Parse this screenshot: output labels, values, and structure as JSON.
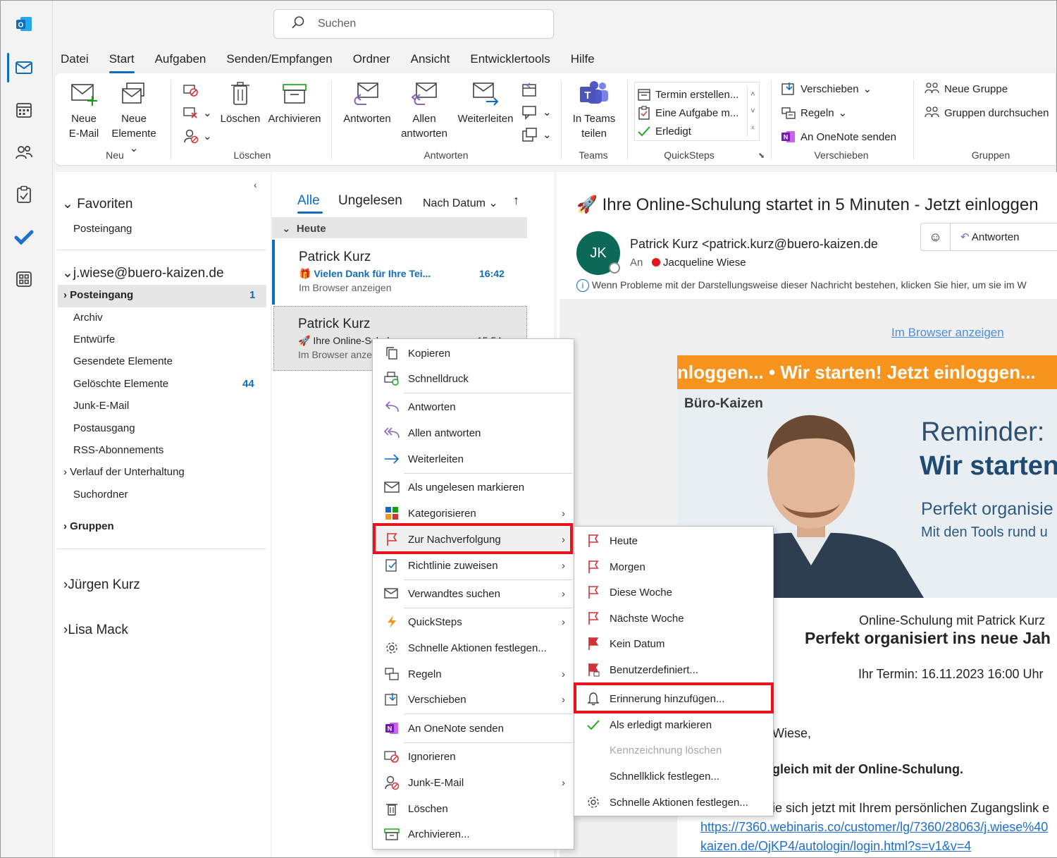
{
  "app": {
    "search_placeholder": "Suchen"
  },
  "tabs": [
    "Datei",
    "Start",
    "Aufgaben",
    "Senden/Empfangen",
    "Ordner",
    "Ansicht",
    "Entwicklertools",
    "Hilfe"
  ],
  "ribbon": {
    "new_mail": [
      "Neue",
      "E-Mail"
    ],
    "new_items": [
      "Neue",
      "Elemente"
    ],
    "group_new": "Neu",
    "delete": "Löschen",
    "archive": "Archivieren",
    "group_delete": "Löschen",
    "reply": "Antworten",
    "reply_all": [
      "Allen",
      "antworten"
    ],
    "forward": "Weiterleiten",
    "group_reply": "Antworten",
    "teams": [
      "In Teams",
      "teilen"
    ],
    "group_teams": "Teams",
    "qs_items": [
      "Termin erstellen...",
      "Eine Aufgabe m...",
      "Erledigt"
    ],
    "group_quicksteps": "QuickSteps",
    "move": "Verschieben",
    "rules": "Regeln",
    "onenote": "An OneNote senden",
    "group_move": "Verschieben",
    "new_group": "Neue Gruppe",
    "browse_groups": "Gruppen durchsuchen",
    "group_groups": "Gruppen"
  },
  "folders": {
    "favorites": "Favoriten",
    "fav_inbox": "Posteingang",
    "account": "j.wiese@buero-kaizen.de",
    "inbox": "Posteingang",
    "inbox_count": "1",
    "archive": "Archiv",
    "drafts": "Entwürfe",
    "sent": "Gesendete Elemente",
    "deleted": "Gelöschte Elemente",
    "deleted_count": "44",
    "junk": "Junk-E-Mail",
    "outbox": "Postausgang",
    "rss": "RSS-Abonnements",
    "history": "Verlauf der Unterhaltung",
    "search": "Suchordner",
    "groups": "Gruppen",
    "person1": "Jürgen Kurz",
    "person2": "Lisa Mack"
  },
  "list": {
    "tab_all": "Alle",
    "tab_unread": "Ungelesen",
    "sort": "Nach Datum",
    "section": "Heute",
    "m1_sender": "Patrick Kurz",
    "m1_subject": "Vielen Dank für Ihre Tei...",
    "m1_time": "16:42",
    "m1_preview": "Im Browser anzeigen",
    "m2_sender": "Patrick Kurz",
    "m2_subject": "Ihre Online-Schulu",
    "m2_time": "15:54",
    "m2_preview": "Im Browser anze"
  },
  "reading": {
    "subject": "Ihre Online-Schulung startet in 5 Minuten - Jetzt einloggen",
    "avatar": "JK",
    "from": "Patrick Kurz <patrick.kurz@buero-kaizen.de",
    "to_label": "An",
    "to_name": "Jacqueline Wiese",
    "reply": "Antworten",
    "info": "Wenn Probleme mit der Darstellungsweise dieser Nachricht bestehen, klicken Sie hier, um sie im W",
    "browser_link": "Im Browser anzeigen",
    "banner": "nloggen... •  Wir starten! Jetzt einloggen...",
    "brand": "Büro-Kaizen",
    "reminder": "Reminder:",
    "wir_starten": "Wir starten",
    "perfekt": "Perfekt organisie",
    "tools": "Mit den Tools rund u",
    "online": "Online-Schulung mit Patrick Kurz",
    "headline": "Perfekt organisiert ins neue Jah",
    "termin": "Ihr Termin: 16.11.2023 16:00 Uhr",
    "greeting": "Wiese,",
    "bold_line": "gleich mit der Online-Schulung.",
    "line3": "ie sich jetzt mit Ihrem persönlichen Zugangslink e",
    "link1": "https://7360.webinaris.co/customer/lg/7360/28063/j.wiese%40",
    "link2": "kaizen.de/OjKP4/autologin/login.html?s=v1&v=4"
  },
  "context_menu": [
    "Kopieren",
    "Schnelldruck",
    "Antworten",
    "Allen antworten",
    "Weiterleiten",
    "Als ungelesen markieren",
    "Kategorisieren",
    "Zur Nachverfolgung",
    "Richtlinie zuweisen",
    "Verwandtes suchen",
    "QuickSteps",
    "Schnelle Aktionen festlegen...",
    "Regeln",
    "Verschieben",
    "An OneNote senden",
    "Ignorieren",
    "Junk-E-Mail",
    "Löschen",
    "Archivieren..."
  ],
  "submenu": [
    "Heute",
    "Morgen",
    "Diese Woche",
    "Nächste Woche",
    "Kein Datum",
    "Benutzerdefiniert...",
    "Erinnerung hinzufügen...",
    "Als erledigt markieren",
    "Kennzeichnung löschen",
    "Schnellklick festlegen...",
    "Schnelle Aktionen festlegen..."
  ],
  "colors": {
    "accent": "#0f6cbd",
    "highlight": "#e8141c",
    "banner": "#f7941d",
    "flag": "#d13438"
  }
}
